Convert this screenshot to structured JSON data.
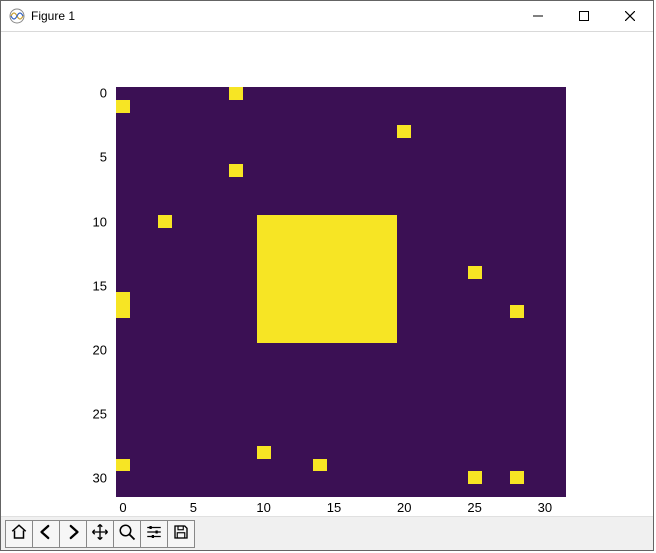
{
  "window": {
    "title": "Figure 1"
  },
  "colors": {
    "background": "#3b1054",
    "foreground": "#f7e524"
  },
  "toolbar": {
    "buttons": [
      {
        "id": "home",
        "tooltip": "Reset original view"
      },
      {
        "id": "back",
        "tooltip": "Back to previous view"
      },
      {
        "id": "forward",
        "tooltip": "Forward to next view"
      },
      {
        "id": "pan",
        "tooltip": "Pan axes"
      },
      {
        "id": "zoom",
        "tooltip": "Zoom to rectangle"
      },
      {
        "id": "config",
        "tooltip": "Configure subplots"
      },
      {
        "id": "save",
        "tooltip": "Save the figure"
      }
    ]
  },
  "chart_data": {
    "type": "heatmap",
    "title": "",
    "xlabel": "",
    "ylabel": "",
    "xlim": [
      -0.5,
      31.5
    ],
    "ylim": [
      31.5,
      -0.5
    ],
    "xticks": [
      0,
      5,
      10,
      15,
      20,
      25,
      30
    ],
    "yticks": [
      0,
      5,
      10,
      15,
      20,
      25,
      30
    ],
    "grid_shape": [
      32,
      32
    ],
    "pixel_value_background": 0,
    "pixel_value_foreground": 1,
    "foreground_points": {
      "comment": "row,col indices of cells that are foreground (value 1)",
      "cells": [
        [
          0,
          8
        ],
        [
          1,
          0
        ],
        [
          3,
          20
        ],
        [
          6,
          8
        ],
        [
          10,
          3
        ],
        [
          14,
          25
        ],
        [
          16,
          0
        ],
        [
          17,
          0
        ],
        [
          17,
          28
        ],
        [
          28,
          10
        ],
        [
          29,
          0
        ],
        [
          29,
          14
        ],
        [
          30,
          25
        ],
        [
          30,
          28
        ]
      ],
      "block": {
        "row_start": 10,
        "row_end": 19,
        "col_start": 10,
        "col_end": 19
      }
    }
  }
}
